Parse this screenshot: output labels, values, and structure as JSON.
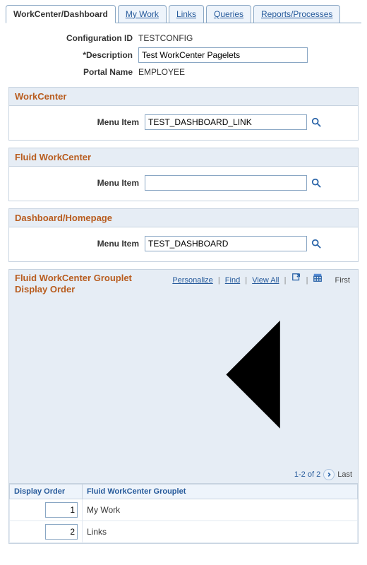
{
  "tabs": [
    {
      "label": "WorkCenter/Dashboard",
      "active": true
    },
    {
      "label": "My Work",
      "u": "M"
    },
    {
      "label": "Links",
      "u": "L"
    },
    {
      "label": "Queries",
      "u": "Q"
    },
    {
      "label": "Reports/Processes",
      "u": "R"
    }
  ],
  "form": {
    "config_id_label": "Configuration ID",
    "config_id_value": "TESTCONFIG",
    "description_label": "*Description",
    "description_value": "Test WorkCenter Pagelets",
    "portal_label": "Portal Name",
    "portal_value": "EMPLOYEE"
  },
  "sections": {
    "workcenter": {
      "title": "WorkCenter",
      "menu_label": "Menu Item",
      "menu_value": "TEST_DASHBOARD_LINK"
    },
    "fluid": {
      "title": "Fluid WorkCenter",
      "menu_label": "Menu Item",
      "menu_value": ""
    },
    "dashboard": {
      "title": "Dashboard/Homepage",
      "menu_label": "Menu Item",
      "menu_value": "TEST_DASHBOARD"
    }
  },
  "grid": {
    "title": "Fluid WorkCenter Grouplet Display Order",
    "toolbar": {
      "personalize": "Personalize",
      "find": "Find",
      "view_all": "View All",
      "first": "First",
      "last": "Last",
      "range": "1-2 of 2"
    },
    "columns": [
      "Display Order",
      "Fluid WorkCenter Grouplet"
    ],
    "rows": [
      {
        "order": "1",
        "name": "My Work"
      },
      {
        "order": "2",
        "name": "Links"
      }
    ]
  }
}
